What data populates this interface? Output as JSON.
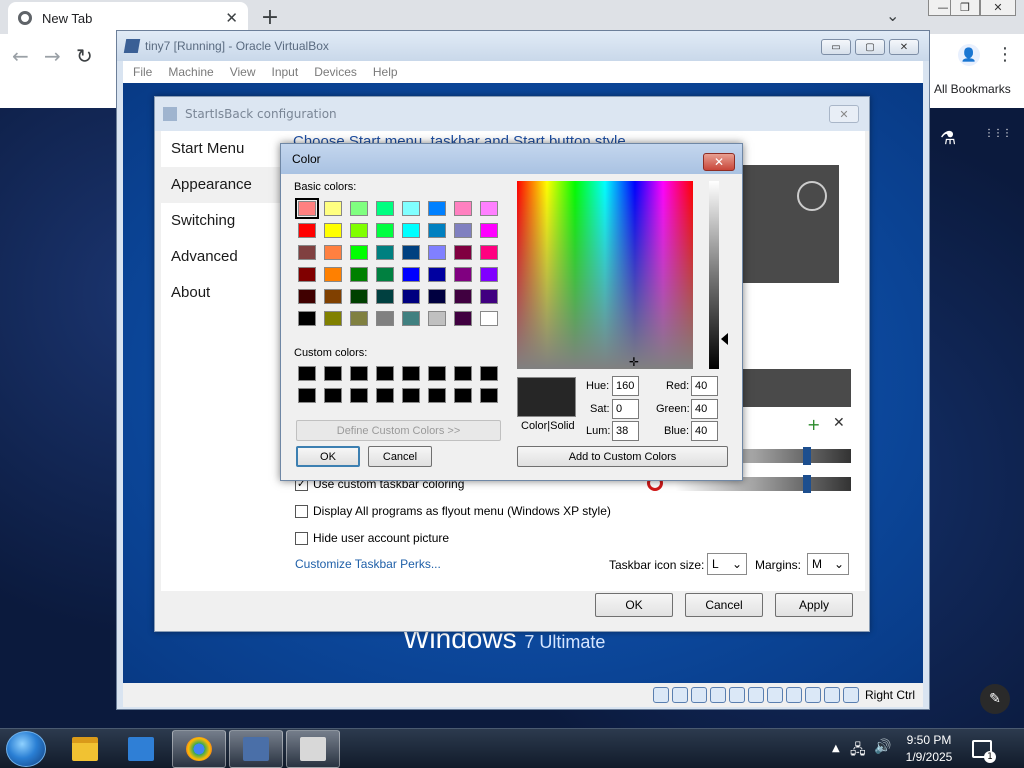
{
  "browser": {
    "tab_title": "New Tab",
    "tab_close": "✕",
    "new_tab": "+",
    "tabs_dropdown": "⌄",
    "window_controls": [
      "—",
      "❐",
      "✕"
    ],
    "back": "←",
    "forward": "→",
    "reload": "↻",
    "profile_icon": "👤",
    "menu": "⋮",
    "all_bookmarks": "All Bookmarks",
    "labs": "⚗",
    "apps": "⋮⋮⋮"
  },
  "vbox": {
    "title": "tiny7 [Running] - Oracle VirtualBox",
    "controls": [
      "▭",
      "▢",
      "✕"
    ],
    "menu": [
      "File",
      "Machine",
      "View",
      "Input",
      "Devices",
      "Help"
    ],
    "right_ctrl": "Right Ctrl",
    "guest_brand": "Windows",
    "guest_edition": "7 Ultimate"
  },
  "startisback": {
    "title": "StartIsBack configuration",
    "close": "✕",
    "nav": [
      "Start Menu",
      "Appearance",
      "Switching",
      "Advanced",
      "About"
    ],
    "active_nav": "Appearance",
    "heading": "Choose Start menu, taskbar and Start button style",
    "plus": "+",
    "x": "✕",
    "checkboxes": [
      {
        "label": "Use custom taskbar coloring",
        "checked": true
      },
      {
        "label": "Display All programs as flyout menu (Windows XP style)",
        "checked": false
      },
      {
        "label": "Hide user account picture",
        "checked": false
      }
    ],
    "check_mark": "✓",
    "customize_link": "Customize Taskbar Perks...",
    "icon_size_label": "Taskbar icon size:",
    "icon_size_value": "L",
    "margins_label": "Margins:",
    "margins_value": "M",
    "dropdown_arrow": "⌄",
    "ok": "OK",
    "cancel": "Cancel",
    "apply": "Apply"
  },
  "color_dialog": {
    "title": "Color",
    "close": "✕",
    "basic_colors_label": "Basic colors:",
    "custom_colors_label": "Custom colors:",
    "basic_colors": [
      [
        "#ff8080",
        "#ffff80",
        "#80ff80",
        "#00ff80",
        "#80ffff",
        "#0080ff",
        "#ff80c0",
        "#ff80ff"
      ],
      [
        "#ff0000",
        "#ffff00",
        "#80ff00",
        "#00ff40",
        "#00ffff",
        "#0080c0",
        "#8080c0",
        "#ff00ff"
      ],
      [
        "#804040",
        "#ff8040",
        "#00ff00",
        "#008080",
        "#004080",
        "#8080ff",
        "#800040",
        "#ff0080"
      ],
      [
        "#800000",
        "#ff8000",
        "#008000",
        "#008040",
        "#0000ff",
        "#0000a0",
        "#800080",
        "#8000ff"
      ],
      [
        "#400000",
        "#804000",
        "#004000",
        "#004040",
        "#000080",
        "#000040",
        "#400040",
        "#400080"
      ],
      [
        "#000000",
        "#808000",
        "#808040",
        "#808080",
        "#408080",
        "#c0c0c0",
        "#400040",
        "#ffffff"
      ]
    ],
    "custom_color": "#000000",
    "define_custom": "Define Custom Colors >>",
    "ok": "OK",
    "cancel": "Cancel",
    "color_solid_label": "Color|Solid",
    "preview_color": "#262626",
    "hue_label": "Hue:",
    "hue": "160",
    "sat_label": "Sat:",
    "sat": "0",
    "lum_label": "Lum:",
    "lum": "38",
    "red_label": "Red:",
    "red": "40",
    "green_label": "Green:",
    "green": "40",
    "blue_label": "Blue:",
    "blue": "40",
    "add_custom": "Add to Custom Colors"
  },
  "taskbar": {
    "tray_arrow": "▲",
    "network": "🖧",
    "volume": "🔊",
    "time": "9:50 PM",
    "date": "1/9/2025",
    "notif_count": "1",
    "edit": "✎"
  }
}
